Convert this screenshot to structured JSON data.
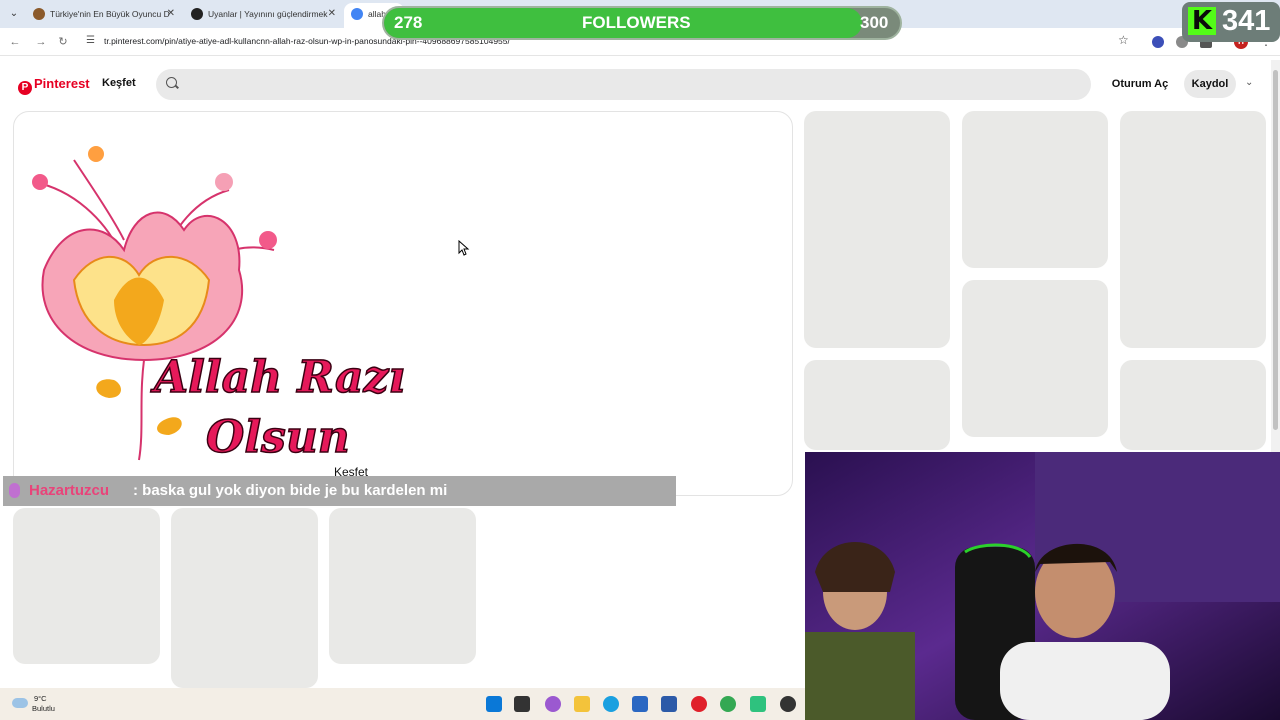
{
  "browser": {
    "tabs": [
      {
        "title": "Türkiye'nin En Büyük Oyuncu D",
        "active": false
      },
      {
        "title": "Uyanlar | Yayınını güçlendirmek",
        "active": false
      },
      {
        "title": "allah",
        "active": true
      }
    ],
    "url": "tr.pinterest.com/pin/atiye-atiye-adl-kullancnn-allah-raz-olsun-wp-in-panosundaki-pin--409688697585104955/",
    "profile_initial": "H"
  },
  "overlay": {
    "followers_current": "278",
    "followers_label": "FOLLOWERS",
    "followers_goal": "300",
    "followers_progress": 0.927,
    "kick_logo": "K",
    "kick_count": "341"
  },
  "pinterest": {
    "logo": "Pinterest",
    "explore": "Keşfet",
    "search_placeholder": "",
    "login": "Oturum Aç",
    "signup": "Kaydol"
  },
  "pin": {
    "line1": "Allah Razı",
    "line2": "Olsun",
    "floating_label": "Keşfet"
  },
  "chat": {
    "username": "Hazartuzcu",
    "message": ": baska gul yok diyon bide je bu kardelen mi"
  },
  "taskbar": {
    "temperature": "9°C",
    "weather": "Bulutlu"
  },
  "colors": {
    "pinterest_red": "#e60023",
    "kick_green": "#53fc18",
    "progress_green": "#3fbf3f"
  }
}
